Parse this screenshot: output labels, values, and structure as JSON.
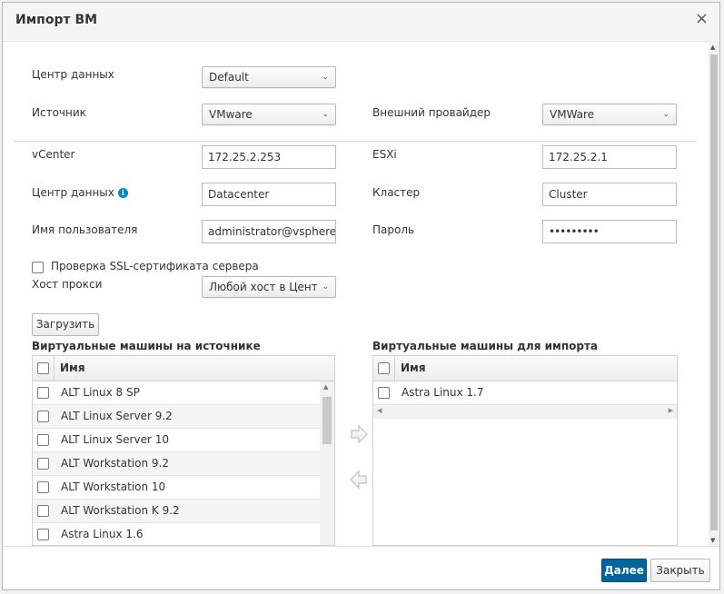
{
  "dialog": {
    "title": "Импорт ВМ",
    "close_glyph": "×"
  },
  "form": {
    "datacenter_label": "Центр данных",
    "datacenter_value": "Default",
    "source_label": "Источник",
    "source_value": "VMware",
    "external_provider_label": "Внешний провайдер",
    "external_provider_value": "VMWare",
    "vcenter_label": "vCenter",
    "vcenter_value": "172.25.2.253",
    "esxi_label": "ESXi",
    "esxi_value": "172.25.2.1",
    "datacenter2_label": "Центр данных",
    "datacenter2_value": "Datacenter",
    "cluster_label": "Кластер",
    "cluster_value": "Cluster",
    "username_label": "Имя пользователя",
    "username_value": "administrator@vsphere.",
    "password_label": "Пароль",
    "password_value": "•••••••••",
    "ssl_check_label": "Проверка SSL-сертификата сервера",
    "proxy_host_label": "Хост прокси",
    "proxy_host_value": "Любой хост в Цент",
    "load_button": "Загрузить"
  },
  "source_vms": {
    "title": "Виртуальные машины на источнике",
    "column_name": "Имя",
    "rows": [
      "ALT Linux 8 SP",
      "ALT Linux Server 9.2",
      "ALT Linux Server 10",
      "ALT Workstation 9.2",
      "ALT Workstation 10",
      "ALT Workstation K 9.2",
      "Astra Linux 1.6"
    ]
  },
  "import_vms": {
    "title": "Виртуальные машины для импорта",
    "column_name": "Имя",
    "rows": [
      "Astra Linux 1.7"
    ]
  },
  "footer": {
    "next_button": "Далее",
    "close_button": "Закрыть"
  },
  "colors": {
    "primary": "#00659c",
    "info_icon": "#0088ce"
  }
}
